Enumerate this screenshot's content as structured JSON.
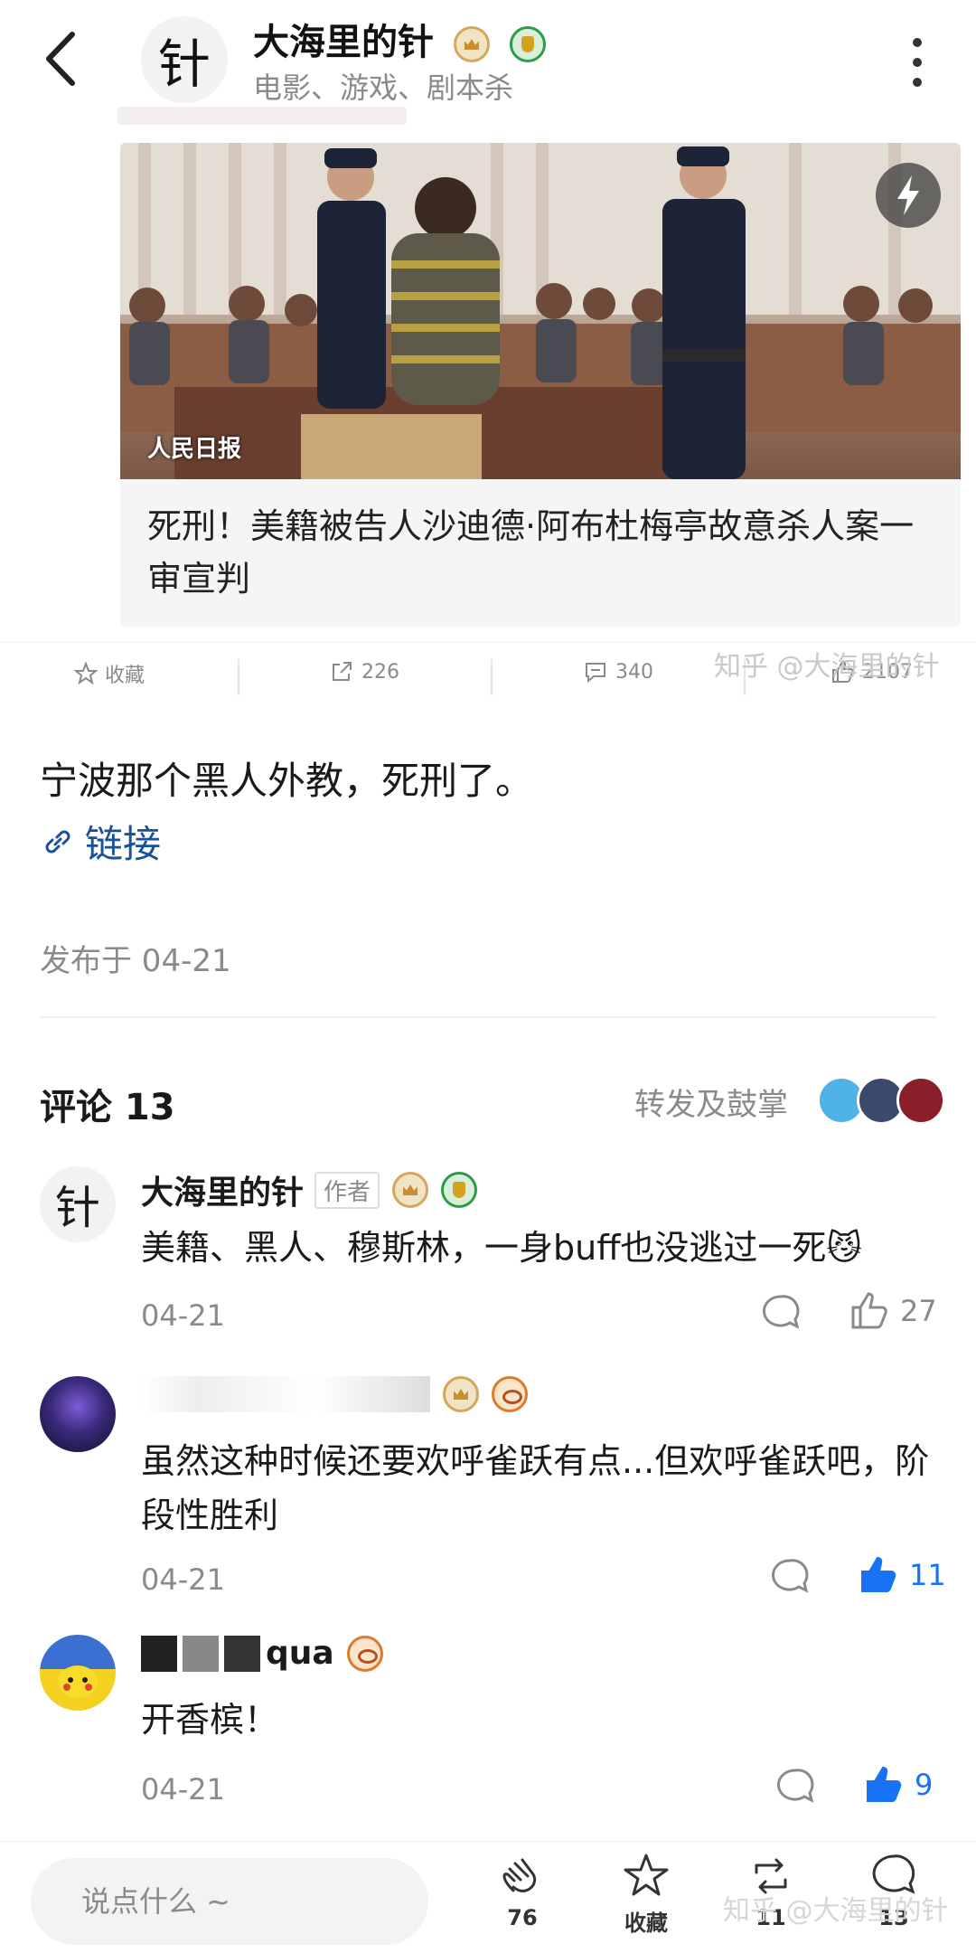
{
  "header": {
    "author_name": "大海里的针",
    "author_subtitle": "电影、游戏、剧本杀",
    "avatar_glyph": "针"
  },
  "card": {
    "image_caption": "人民日报",
    "title": "死刑！美籍被告人沙迪德·阿布杜梅亭故意杀人案一审宣判"
  },
  "actions": {
    "favorite_label": "收藏",
    "share_count": "226",
    "comment_count": "340",
    "like_count": "2107"
  },
  "watermark": "知乎 @大海里的针",
  "post": {
    "text": "宁波那个黑人外教，死刑了。",
    "link_label": "链接",
    "published": "发布于 04-21"
  },
  "comments_section": {
    "title": "评论 13",
    "reposts_label": "转发及鼓掌"
  },
  "comments": [
    {
      "name": "大海里的针",
      "author_tag": "作者",
      "text": "美籍、黑人、穆斯林，一身buff也没逃过一死😼",
      "date": "04-21",
      "likes": "27"
    },
    {
      "name": "",
      "text": "虽然这种时候还要欢呼雀跃有点...但欢呼雀跃吧，阶段性胜利",
      "date": "04-21",
      "likes": "11"
    },
    {
      "name": "qua",
      "text": "开香槟！",
      "date": "04-21",
      "likes": "9"
    }
  ],
  "bottom_bar": {
    "input_placeholder": "说点什么 ~",
    "clap_count": "76",
    "favorite_label": "收藏",
    "repost_count": "11",
    "comment_count": "13"
  },
  "colors": {
    "accent_blue": "#1772f6",
    "link_blue": "#175199",
    "muted_gray": "#8a8a8a"
  }
}
